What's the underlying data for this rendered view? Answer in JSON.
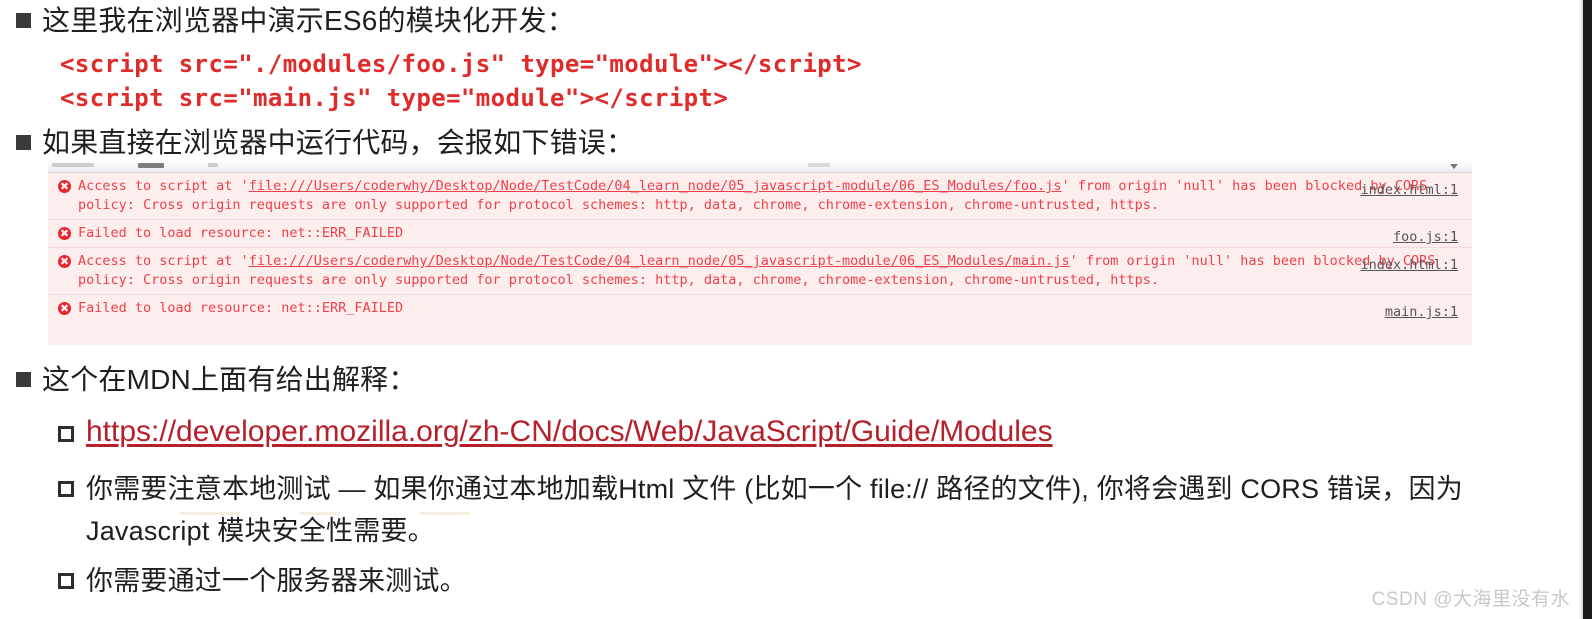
{
  "slide": {
    "watermark": "CSDN @大海里没有水"
  },
  "bullets": {
    "b1": "这里我在浏览器中演示ES6的模块化开发：",
    "b2": "如果直接在浏览器中运行代码，会报如下错误：",
    "b3": "这个在MDN上面有给出解释："
  },
  "code": {
    "line1": "<script src=\"./modules/foo.js\" type=\"module\"></script>",
    "line2": "<script src=\"main.js\" type=\"module\"></script>"
  },
  "console": {
    "errors": [
      {
        "icon": "error-circle-icon",
        "text_pre": "Access to script at '",
        "text_link": "file:///Users/coderwhy/Desktop/Node/TestCode/04_learn_node/05_javascript-module/06_ES_Modules/foo.js",
        "text_post": "' from origin 'null' has been blocked by CORS policy: Cross origin requests are only supported for protocol schemes: http, data, chrome, chrome-extension, chrome-untrusted, https.",
        "source": "index.html:1"
      },
      {
        "icon": "error-circle-icon",
        "text_pre": "",
        "text_link": "",
        "text_post": "Failed to load resource: net::ERR_FAILED",
        "source": "foo.js:1"
      },
      {
        "icon": "error-circle-icon",
        "text_pre": "Access to script at '",
        "text_link": "file:///Users/coderwhy/Desktop/Node/TestCode/04_learn_node/05_javascript-module/06_ES_Modules/main.js",
        "text_post": "' from origin 'null' has been blocked by CORS policy: Cross origin requests are only supported for protocol schemes: http, data, chrome, chrome-extension, chrome-untrusted, https.",
        "source": "index.html:1"
      },
      {
        "icon": "error-circle-icon",
        "text_pre": "",
        "text_link": "",
        "text_post": "Failed to load resource: net::ERR_FAILED",
        "source": "main.js:1"
      }
    ]
  },
  "mdn": {
    "link": "https://developer.mozilla.org/zh-CN/docs/Web/JavaScript/Guide/Modules",
    "note_line1": "你需要注意本地测试 — 如果你通过本地加载Html 文件 (比如一个 file:// 路径的文件), 你将会遇到 CORS 错误，因为",
    "note_line2": "Javascript 模块安全性需要。",
    "note2": "你需要通过一个服务器来测试。"
  }
}
